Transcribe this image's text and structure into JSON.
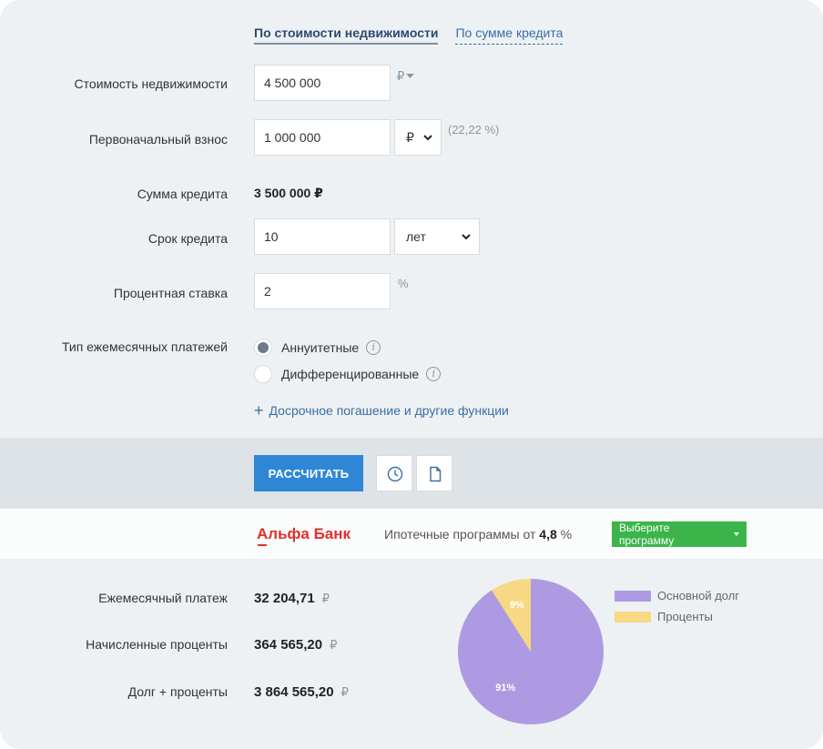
{
  "tabs": {
    "by_property": "По стоимости недвижимости",
    "by_loan": "По сумме кредита"
  },
  "form": {
    "property_cost": {
      "label": "Стоимость недвижимости",
      "value": "4 500 000",
      "unit": "₽"
    },
    "down_payment": {
      "label": "Первоначальный взнос",
      "value": "1 000 000",
      "unit_select": "₽",
      "percent": "(22,22 %)"
    },
    "loan_amount": {
      "label": "Сумма кредита",
      "value": "3 500 000 ₽"
    },
    "term": {
      "label": "Срок кредита",
      "value": "10",
      "unit_select": "лет"
    },
    "rate": {
      "label": "Процентная ставка",
      "value": "2",
      "unit": "%"
    },
    "payment_type": {
      "label": "Тип ежемесячных платежей",
      "options": [
        {
          "label": "Аннуитетные",
          "checked": true
        },
        {
          "label": "Дифференцированные",
          "checked": false
        }
      ]
    },
    "extra_link": "Досрочное погашение и другие функции"
  },
  "actions": {
    "calculate": "РАССЧИТАТЬ",
    "history_icon": "clock-icon",
    "document_icon": "document-icon"
  },
  "bank": {
    "logo": "Альфа Банк",
    "text_prefix": "Ипотечные программы от",
    "rate": "4,8",
    "text_suffix": "%",
    "choose": "Выберите программу"
  },
  "results": {
    "monthly_payment": {
      "label": "Ежемесячный платеж",
      "value": "32 204,71",
      "unit": "₽"
    },
    "interest": {
      "label": "Начисленные проценты",
      "value": "364 565,20",
      "unit": "₽"
    },
    "total": {
      "label": "Долг + проценты",
      "value": "3 864 565,20",
      "unit": "₽"
    }
  },
  "chart_data": {
    "type": "pie",
    "series": [
      {
        "name": "Основной долг",
        "value": 91,
        "label": "91%",
        "color": "#ae9ae3"
      },
      {
        "name": "Проценты",
        "value": 9,
        "label": "9%",
        "color": "#f6d982"
      }
    ]
  },
  "colors": {
    "accent": "#2f86d6",
    "bank_red": "#e3302a",
    "green": "#3bb54a"
  }
}
